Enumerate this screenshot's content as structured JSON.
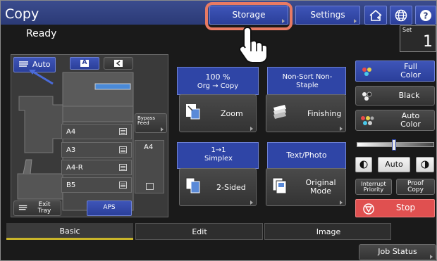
{
  "header": {
    "title": "Copy",
    "status": "Ready",
    "tabs": [
      "Storage",
      "Settings"
    ],
    "set_label": "Set",
    "set_value": "1"
  },
  "machine": {
    "auto_label": "Auto",
    "a_label": "A",
    "paper_trays": [
      "A4",
      "A3",
      "A4-R",
      "B5"
    ],
    "bypass_label": "Bypass Feed",
    "bypass_size": "A4",
    "exit_tray_label": "Exit Tray",
    "aps_label": "APS"
  },
  "functions": {
    "ratio": "100 %",
    "org_copy": "Org → Copy",
    "zoom": "Zoom",
    "sort": "Non-Sort Non-Staple",
    "finishing": "Finishing",
    "simplex": "1→1 Simplex",
    "two_sided": "2-Sided",
    "textphoto": "Text/Photo",
    "original_mode": "Original Mode"
  },
  "color": {
    "full": "Full Color",
    "black": "Black",
    "auto": "Auto Color"
  },
  "density": {
    "auto": "Auto"
  },
  "actions": {
    "interrupt": "Interrupt Priority",
    "proof": "Proof Copy",
    "stop": "Stop"
  },
  "bottom_tabs": [
    "Basic",
    "Edit",
    "Image"
  ],
  "job_status": "Job Status",
  "colors": {
    "accent_blue": "#2f45a6",
    "highlight": "#e87a63",
    "stop_red": "#e05050",
    "active_tab": "#c9b52a"
  }
}
